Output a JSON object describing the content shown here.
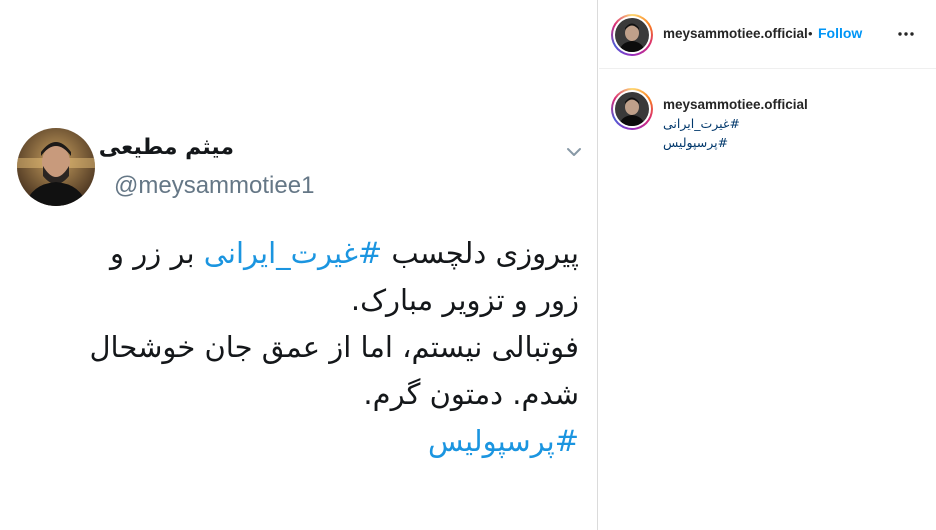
{
  "tweet": {
    "display_name": "میثم مطیعی",
    "handle": "@meysammotiee1",
    "lines": [
      {
        "parts": [
          {
            "text": "پیروزی دلچسب ",
            "hashtag": false
          },
          {
            "text": "#غیرت_ایرانی",
            "hashtag": true
          },
          {
            "text": " بر زر و",
            "hashtag": false
          }
        ]
      },
      {
        "parts": [
          {
            "text": "زور و تزویر مبارک.",
            "hashtag": false
          }
        ]
      },
      {
        "parts": [
          {
            "text": "فوتبالی نیستم، اما از عمق جان خوشحال",
            "hashtag": false
          }
        ]
      },
      {
        "parts": [
          {
            "text": "شدم. دمتون گرم.",
            "hashtag": false
          }
        ]
      },
      {
        "parts": [
          {
            "text": "#پرسپولیس",
            "hashtag": true
          }
        ]
      }
    ]
  },
  "instagram": {
    "header": {
      "username": "meysammotiee.official",
      "separator": "•",
      "follow_label": "Follow"
    },
    "caption": {
      "username": "meysammotiee.official",
      "hashtags": [
        "#غیرت_ایرانی",
        "#پرسپولیس"
      ]
    }
  },
  "colors": {
    "hashtag_twitter": "#1b95e0",
    "follow_blue": "#0095f6",
    "hashtag_instagram": "#00376b"
  }
}
